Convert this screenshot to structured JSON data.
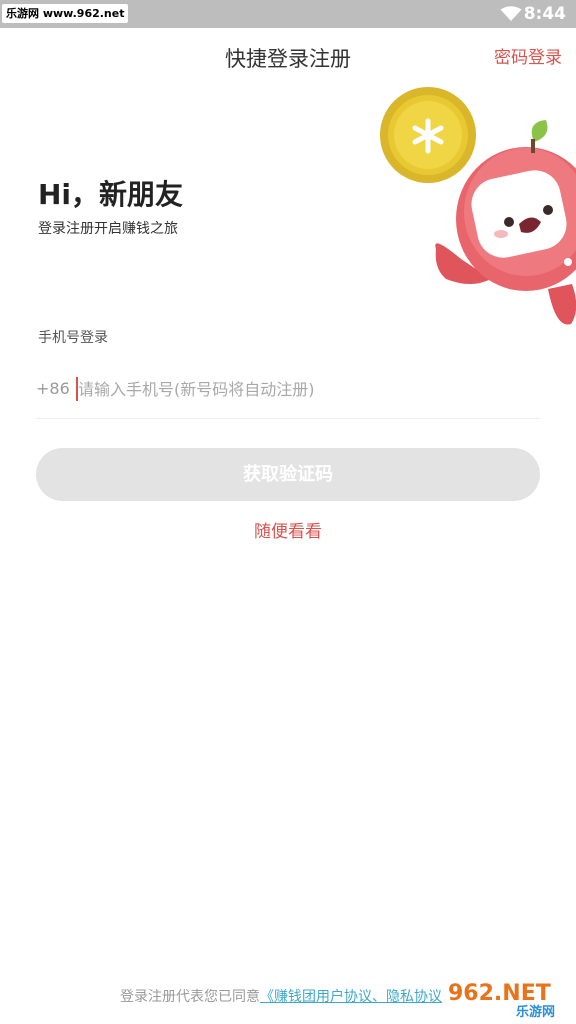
{
  "status_bar": {
    "watermark": "乐游网 www.962.net",
    "time": "8:44",
    "wifi_icon": "wifi-icon"
  },
  "header": {
    "title": "快捷登录注册",
    "password_login": "密码登录"
  },
  "greeting": {
    "headline": "Hi，新朋友",
    "subtitle": "登录注册开启赚钱之旅"
  },
  "mascot": {
    "icon": "apple-mascot-with-coin"
  },
  "phone_login": {
    "label": "手机号登录",
    "country_code": "+86",
    "placeholder": "请输入手机号(新号码将自动注册)",
    "value": ""
  },
  "actions": {
    "get_code": "获取验证码",
    "browse": "随便看看"
  },
  "footer": {
    "agreement_prefix": "登录注册代表您已同意",
    "agreement_link": "《赚钱团用户协议、隐私协议",
    "watermark_logo_text": "962.NET",
    "watermark_logo_sub": "乐游网"
  },
  "colors": {
    "accent": "#d9534f",
    "button_disabled": "#e3e3e3",
    "link": "#3ea8c9",
    "status_bar": "#bdbdbd"
  }
}
